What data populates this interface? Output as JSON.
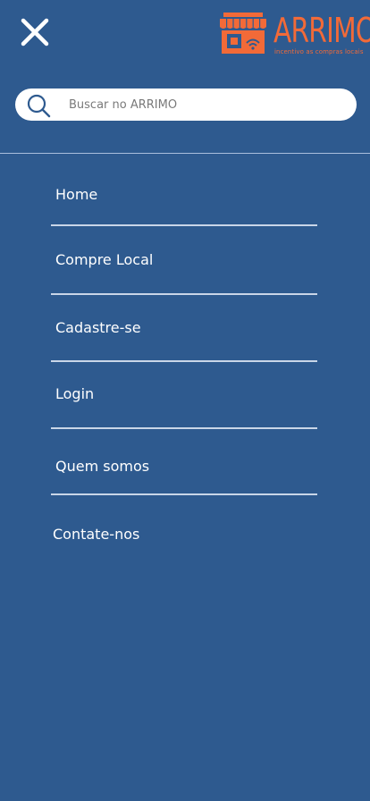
{
  "brand": {
    "name": "ARRIMO",
    "tagline": "incentivo as compras locais",
    "color": "#f26a38"
  },
  "header": {
    "close_icon": "close-icon"
  },
  "search": {
    "placeholder": "Buscar no ARRIMO",
    "value": "",
    "icon": "search-icon"
  },
  "menu": {
    "items": [
      {
        "label": "Home"
      },
      {
        "label": "Compre Local"
      },
      {
        "label": "Cadastre-se"
      },
      {
        "label": "Login"
      },
      {
        "label": "Quem somos"
      },
      {
        "label": "Contate-nos"
      }
    ]
  },
  "colors": {
    "background": "#2e5a8f",
    "accent": "#f26a38",
    "divider": "#c9d6e8"
  }
}
